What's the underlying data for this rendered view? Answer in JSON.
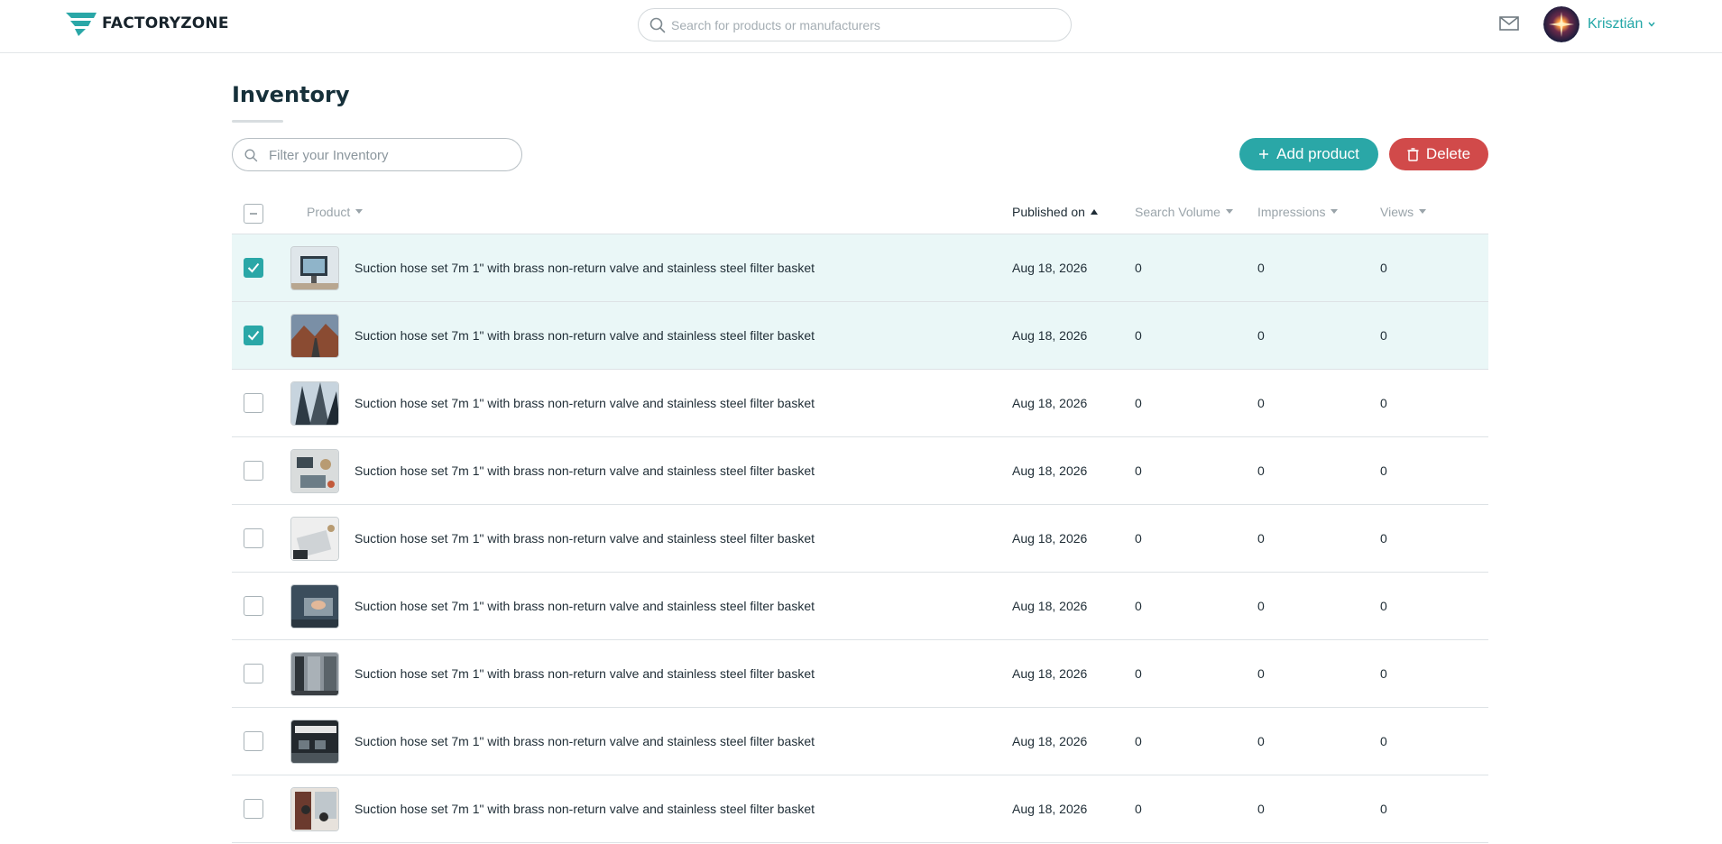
{
  "header": {
    "brand": "FACTORYZONE",
    "logo_icon": "factoryzone-logo",
    "search_placeholder": "Search for products or manufacturers",
    "mail_icon": "envelope-icon",
    "user_name": "Krisztián"
  },
  "page": {
    "title": "Inventory",
    "filter_placeholder": "Filter your Inventory",
    "add_label": "Add product",
    "delete_label": "Delete"
  },
  "colors": {
    "accent": "#2aa7a7",
    "danger": "#d14a4a",
    "selected_row": "#eaf7f7"
  },
  "table": {
    "columns": {
      "product": "Product",
      "published": "Published on",
      "search_volume": "Search Volume",
      "impressions": "Impressions",
      "views": "Views"
    },
    "sorted_by": "published",
    "sort_direction": "ascending",
    "rows": [
      {
        "name": "Suction hose set 7m 1\" with brass non-return valve and stainless steel filter basket",
        "published": "Aug 18, 2026",
        "search_volume": "0",
        "impressions": "0",
        "views": "0",
        "checked": true,
        "thumb": "office-monitor-photo"
      },
      {
        "name": "Suction hose set 7m 1\" with brass non-return valve and stainless steel filter basket",
        "published": "Aug 18, 2026",
        "search_volume": "0",
        "impressions": "0",
        "views": "0",
        "checked": true,
        "thumb": "mountain-road-photo"
      },
      {
        "name": "Suction hose set 7m 1\" with brass non-return valve and stainless steel filter basket",
        "published": "Aug 18, 2026",
        "search_volume": "0",
        "impressions": "0",
        "views": "0",
        "checked": false,
        "thumb": "skyscrapers-photo"
      },
      {
        "name": "Suction hose set 7m 1\" with brass non-return valve and stainless steel filter basket",
        "published": "Aug 18, 2026",
        "search_volume": "0",
        "impressions": "0",
        "views": "0",
        "checked": false,
        "thumb": "desk-flatlay-photo"
      },
      {
        "name": "Suction hose set 7m 1\" with brass non-return valve and stainless steel filter basket",
        "published": "Aug 18, 2026",
        "search_volume": "0",
        "impressions": "0",
        "views": "0",
        "checked": false,
        "thumb": "laptop-desk-photo"
      },
      {
        "name": "Suction hose set 7m 1\" with brass non-return valve and stainless steel filter basket",
        "published": "Aug 18, 2026",
        "search_volume": "0",
        "impressions": "0",
        "views": "0",
        "checked": false,
        "thumb": "typing-laptop-photo"
      },
      {
        "name": "Suction hose set 7m 1\" with brass non-return valve and stainless steel filter basket",
        "published": "Aug 18, 2026",
        "search_volume": "0",
        "impressions": "0",
        "views": "0",
        "checked": false,
        "thumb": "office-interior-photo"
      },
      {
        "name": "Suction hose set 7m 1\" with brass non-return valve and stainless steel filter basket",
        "published": "Aug 18, 2026",
        "search_volume": "0",
        "impressions": "0",
        "views": "0",
        "checked": false,
        "thumb": "dark-office-photo"
      },
      {
        "name": "Suction hose set 7m 1\" with brass non-return valve and stainless steel filter basket",
        "published": "Aug 18, 2026",
        "search_volume": "0",
        "impressions": "0",
        "views": "0",
        "checked": false,
        "thumb": "meeting-room-photo"
      }
    ]
  }
}
